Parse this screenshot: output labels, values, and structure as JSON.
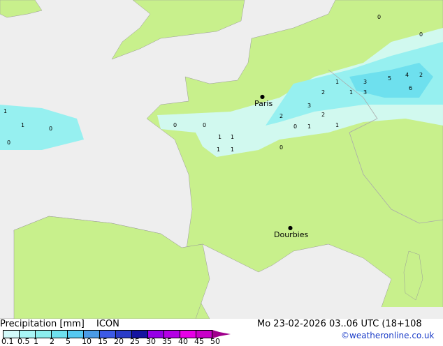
{
  "map": {
    "colors": {
      "sea": "#eeeeee",
      "land": "#c8f08c",
      "border": "#aaaaaa"
    },
    "cities": [
      {
        "name": "Paris"
      },
      {
        "name": "Dourbies"
      }
    ],
    "values": [
      "0",
      "1",
      "1",
      "2",
      "3",
      "2",
      "1",
      "1",
      "3",
      "5",
      "4",
      "2",
      "3",
      "6",
      "0",
      "1",
      "1",
      "0",
      "0",
      "1",
      "2",
      "1",
      "0",
      "0",
      "1",
      "1",
      "0",
      "0"
    ]
  },
  "footer": {
    "title": "Precipitation [mm]",
    "model": "ICON",
    "datetime": "Mo 23-02-2026 03..06 UTC (18+108",
    "credit": "©weatheronline.co.uk",
    "legend_colors": [
      "#d2fafa",
      "#a8f5f5",
      "#8ceeee",
      "#6ee0ee",
      "#55c8f0",
      "#4b9be6",
      "#3c5ae6",
      "#2a3cc8",
      "#1414a0",
      "#9600e6",
      "#b400e6",
      "#e600e6",
      "#c800c8"
    ],
    "legend_ticks": [
      "0.1",
      "0.5",
      "1",
      "2",
      "5",
      "10",
      "15",
      "20",
      "25",
      "30",
      "35",
      "40",
      "45",
      "50"
    ]
  }
}
